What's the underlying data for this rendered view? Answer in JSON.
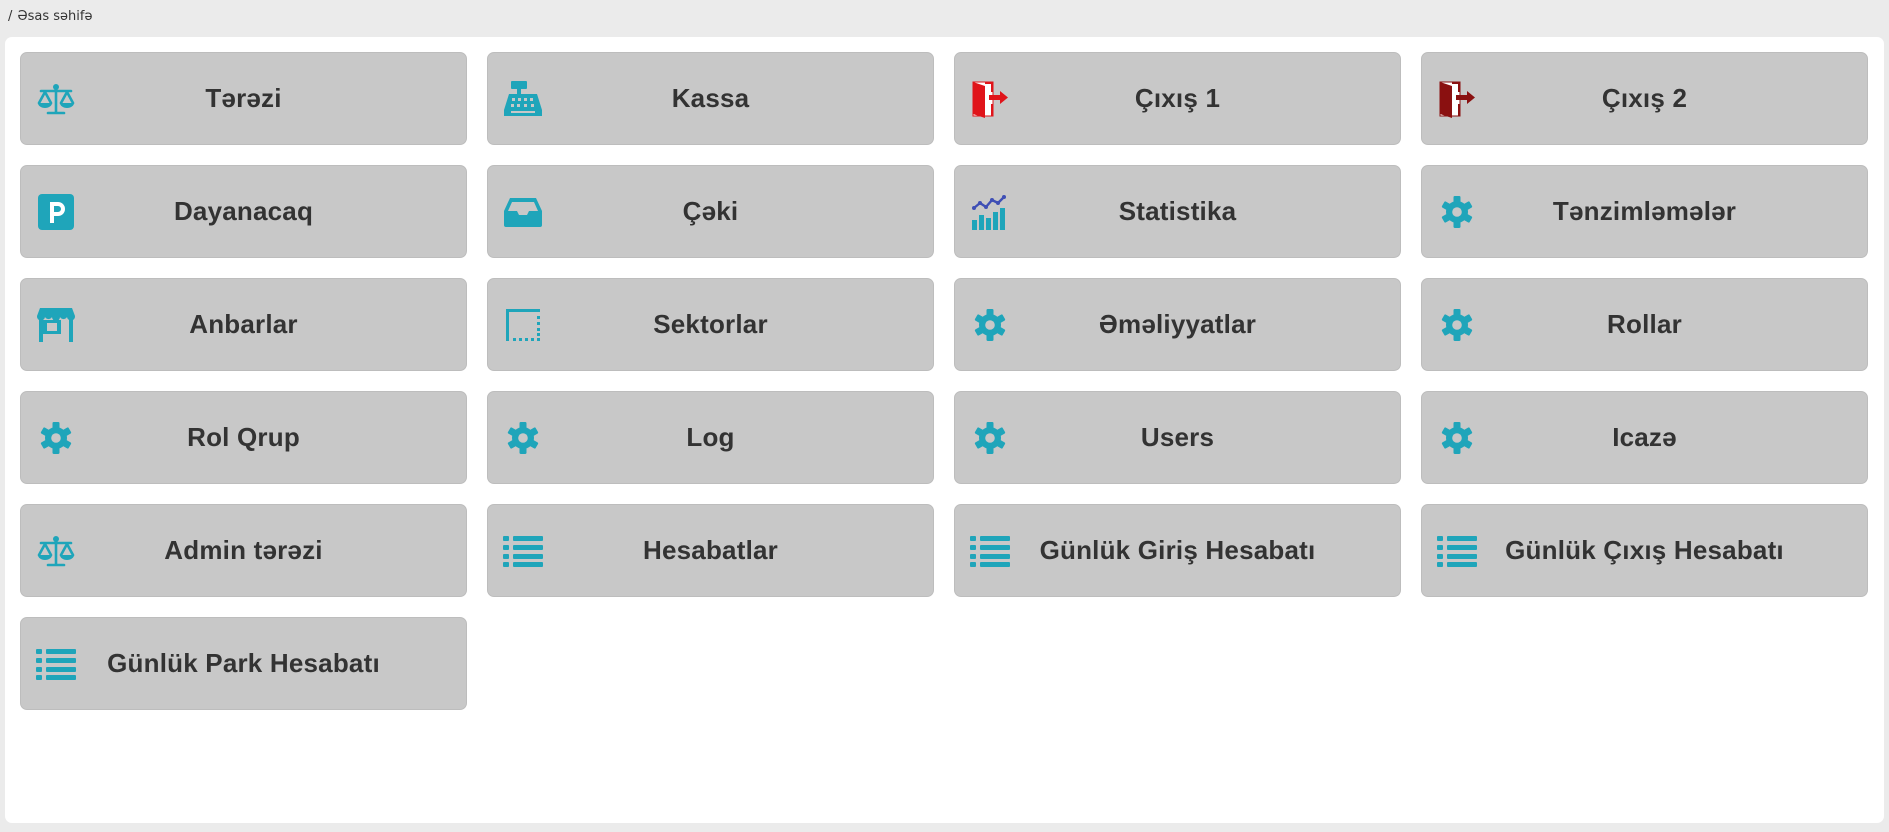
{
  "breadcrumb": {
    "separator": "/",
    "current": "Əsas səhifə"
  },
  "colors": {
    "accent": "#1fa5ba",
    "exit1": "#e0141a",
    "exit2": "#8a1010",
    "tile_bg": "#c8c8c8",
    "text": "#333333"
  },
  "tiles": [
    {
      "label": "Tərəzi",
      "icon": "scale-icon"
    },
    {
      "label": "Kassa",
      "icon": "cash-register-icon"
    },
    {
      "label": "Çıxış 1",
      "icon": "exit-door-icon"
    },
    {
      "label": "Çıxış 2",
      "icon": "exit-door-dark-icon"
    },
    {
      "label": "Dayanacaq",
      "icon": "parking-icon"
    },
    {
      "label": "Çəki",
      "icon": "inbox-tray-icon"
    },
    {
      "label": "Statistika",
      "icon": "statistics-chart-icon"
    },
    {
      "label": "Tənzimləmələr",
      "icon": "gear-icon"
    },
    {
      "label": "Anbarlar",
      "icon": "warehouse-store-icon"
    },
    {
      "label": "Sektorlar",
      "icon": "sector-border-icon"
    },
    {
      "label": "Əməliyyatlar",
      "icon": "gear-icon"
    },
    {
      "label": "Rollar",
      "icon": "gear-icon"
    },
    {
      "label": "Rol Qrup",
      "icon": "gear-icon"
    },
    {
      "label": "Log",
      "icon": "gear-icon"
    },
    {
      "label": "Users",
      "icon": "gear-icon"
    },
    {
      "label": "Icazə",
      "icon": "gear-icon"
    },
    {
      "label": "Admin tərəzi",
      "icon": "scale-icon"
    },
    {
      "label": "Hesabatlar",
      "icon": "list-icon"
    },
    {
      "label": "Günlük Giriş Hesabatı",
      "icon": "list-icon"
    },
    {
      "label": "Günlük Çıxış Hesabatı",
      "icon": "list-icon"
    },
    {
      "label": "Günlük Park Hesabatı",
      "icon": "list-icon"
    }
  ]
}
